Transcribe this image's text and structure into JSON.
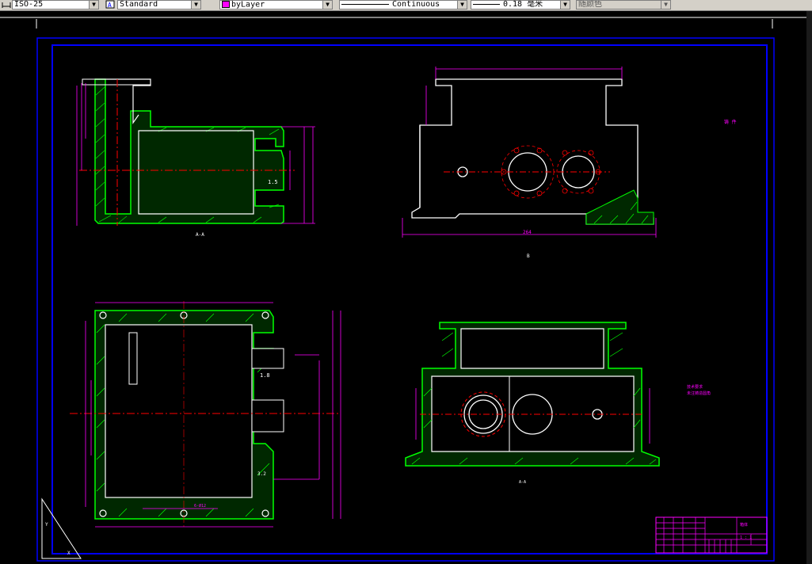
{
  "toolbar": {
    "dimstyle_value": "ISO-25",
    "textstyle_value": "Standard",
    "layer_value": "byLayer",
    "layer_color": "#ff00ff",
    "linetype_value": "Continuous",
    "lineweight_value": "0.18 毫米",
    "plotstyle_value": "随颜色",
    "dropdown_glyph": "▼"
  },
  "drawing": {
    "background": "#000000",
    "frame_color": "#0000ff",
    "outline_color": "#ffffff",
    "hatch_color": "#00ff00",
    "dimension_color": "#ff00ff",
    "centerline_color": "#ff0000",
    "labels": {
      "left_section_mark": "1.5",
      "top_dim_width": "264",
      "mid_dim_value": "1.8",
      "note_top_right": "铸 件",
      "note_mid_right_1": "技术要求",
      "note_mid_right_2": "未注铸造圆角",
      "view_label_a": "A-A",
      "view_label_b": "B",
      "plan_dim": "6-Ø12",
      "plan_dim_2": "3.2",
      "title_block_name": "箱体",
      "title_block_scale": "1 : 1"
    }
  }
}
